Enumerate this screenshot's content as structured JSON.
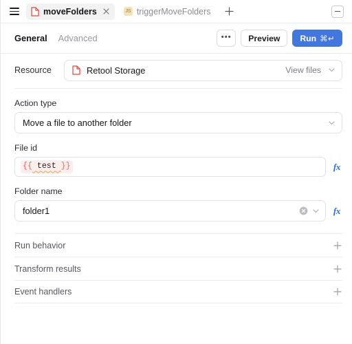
{
  "tabbar": {
    "menu_icon": "hamburger-menu-icon",
    "tabs": [
      {
        "label": "moveFolders",
        "icon": "red-document-icon",
        "active": true,
        "close_icon": "close-icon"
      },
      {
        "label": "triggerMoveFolders",
        "icon": "js-badge-icon",
        "active": false
      }
    ],
    "add_tab_icon": "plus-icon",
    "collapse_icon": "minimize-panel-icon"
  },
  "toolbar": {
    "tabs": [
      {
        "label": "General",
        "active": true
      },
      {
        "label": "Advanced",
        "active": false
      }
    ],
    "more_label": "•••",
    "preview_label": "Preview",
    "run_label": "Run",
    "run_shortcut": "⌘↵",
    "run_color": "#4277e0"
  },
  "resource": {
    "label": "Resource",
    "icon": "red-document-icon",
    "value": "Retool Storage",
    "view_files_label": "View files",
    "chevron_icon": "chevron-down-icon"
  },
  "action_type": {
    "label": "Action type",
    "value": "Move a file to another folder",
    "chevron_icon": "chevron-down-icon"
  },
  "file_id": {
    "label": "File id",
    "open_brace": "{{",
    "expression": " test ",
    "close_brace": "}}",
    "fx_label": "fx",
    "brace_color": "#e8685f",
    "chip_bg": "#fdeeee",
    "squiggle_color": "#f0a24a"
  },
  "folder_name": {
    "label": "Folder name",
    "value": "folder1",
    "clear_icon": "clear-circle-icon",
    "chevron_icon": "chevron-down-icon",
    "fx_label": "fx"
  },
  "sections": [
    {
      "title": "Run behavior",
      "expand_icon": "plus-icon"
    },
    {
      "title": "Transform results",
      "expand_icon": "plus-icon"
    },
    {
      "title": "Event handlers",
      "expand_icon": "plus-icon"
    }
  ]
}
